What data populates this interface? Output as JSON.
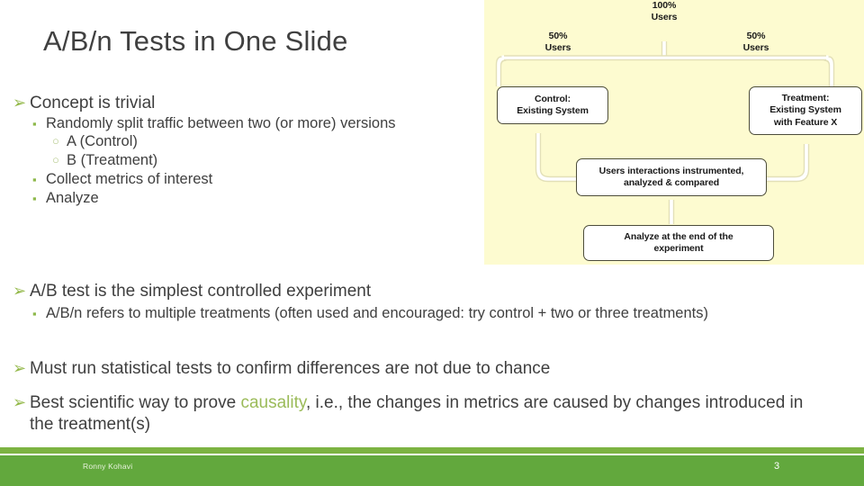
{
  "slide": {
    "title": "A/B/n Tests in One Slide",
    "page_number": "3",
    "author": "Ronny Kohavi",
    "colors": {
      "title_text": "#404040",
      "body_text": "#3f3f3f",
      "arrow_bullet": "#94b94b",
      "square_bullet": "#8db84a",
      "circle_bullet": "#b5c98a",
      "accent_green": "#9bbb59",
      "footer_band": "#62a83d",
      "footer_stripe": "#7cb342",
      "diagram_background": "#fdfbd0"
    }
  },
  "bullets": {
    "arrow_glyph": "➢",
    "square_glyph": "▪",
    "circle_glyph": "○",
    "group_top": [
      {
        "level": 1,
        "text": "Concept is trivial"
      },
      {
        "level": 2,
        "text": "Randomly split traffic between two (or more) versions"
      },
      {
        "level": 3,
        "text": "A (Control)"
      },
      {
        "level": 3,
        "text": "B (Treatment)"
      },
      {
        "level": 2,
        "text": "Collect metrics of interest"
      },
      {
        "level": 2,
        "text": "Analyze"
      }
    ],
    "group_middle": [
      {
        "level": 1,
        "text": "A/B test is the simplest controlled experiment"
      },
      {
        "level": 2,
        "text": "A/B/n refers to multiple treatments (often used and encouraged: try control + two or three treatments)"
      }
    ],
    "group_bottom_1": {
      "level": 1,
      "text": "Must run statistical tests to confirm differences are not due to chance"
    },
    "group_bottom_2": {
      "level": 1,
      "text_before": "Best scientific way to prove ",
      "accent_word": "causality",
      "text_after": ", i.e., the changes in metrics are caused by changes introduced in the treatment(s)"
    }
  },
  "diagram": {
    "label_100": "100%\nUsers",
    "label_50_left": "50%\nUsers",
    "label_50_right": "50%\nUsers",
    "box_control": "Control:\nExisting System",
    "box_treatment": "Treatment:\nExisting System\nwith Feature X",
    "box_instrumented": "Users interactions instrumented,\nanalyzed & compared",
    "box_analyze": "Analyze at the end of the\nexperiment",
    "users_icon_name": "two-people-icon"
  }
}
